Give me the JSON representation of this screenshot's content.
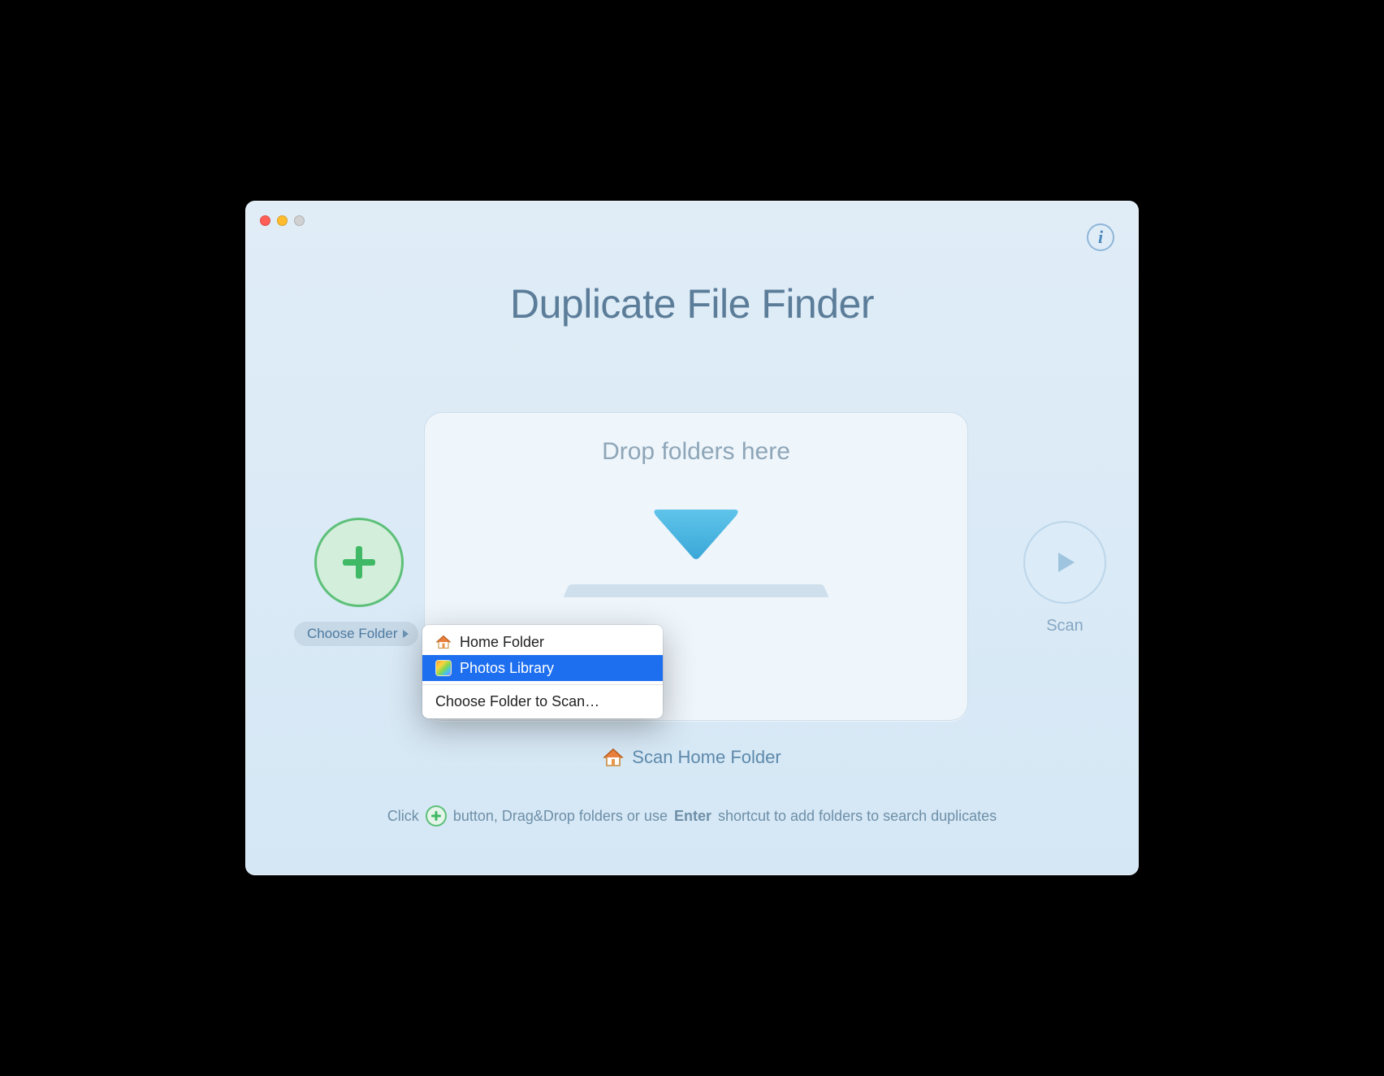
{
  "app": {
    "title": "Duplicate File Finder"
  },
  "info_icon": "i",
  "drop": {
    "title": "Drop folders here"
  },
  "left": {
    "choose_label": "Choose Folder"
  },
  "right": {
    "scan_label": "Scan"
  },
  "menu": {
    "home_label": "Home Folder",
    "photos_label": "Photos Library",
    "choose_label": "Choose Folder to Scan…"
  },
  "scan_home_label": "Scan Home Folder",
  "hint": {
    "pre": "Click",
    "mid": "button, Drag&Drop folders or use",
    "enter": "Enter",
    "post": "shortcut to add folders to search duplicates"
  }
}
